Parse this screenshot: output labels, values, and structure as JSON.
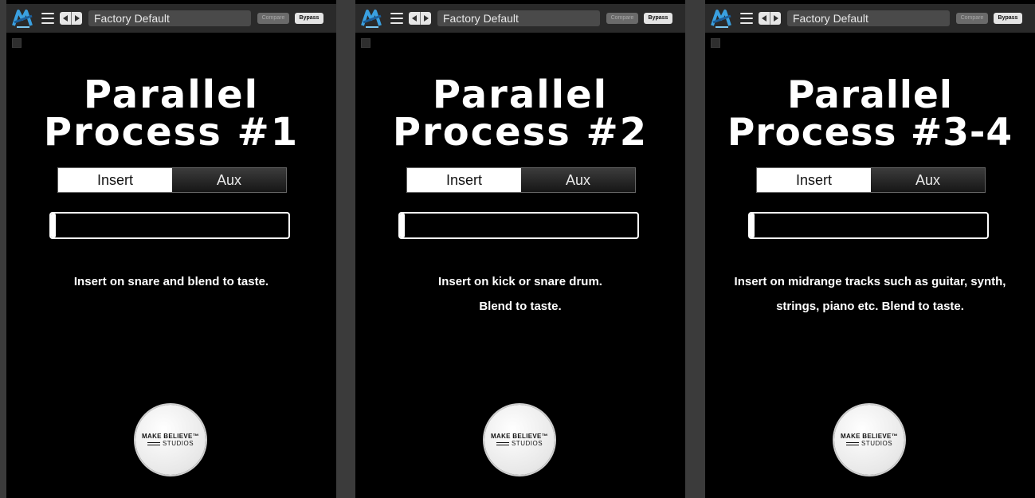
{
  "toolbar": {
    "preset_name": "Factory Default",
    "compare_label": "Compare",
    "bypass_label": "Bypass"
  },
  "panels": [
    {
      "title_line1": "Parallel",
      "title_line2": "Process #1",
      "toggle_insert": "Insert",
      "toggle_aux": "Aux",
      "selected": "Insert",
      "blend_level": 0.02,
      "description_line1": "Insert on snare and blend to taste.",
      "description_line2": ""
    },
    {
      "title_line1": "Parallel",
      "title_line2": "Process #2",
      "toggle_insert": "Insert",
      "toggle_aux": "Aux",
      "selected": "Insert",
      "blend_level": 0.02,
      "description_line1": "Insert on kick or snare drum.",
      "description_line2": "Blend to taste."
    },
    {
      "title_line1": "Parallel",
      "title_line2": "Process #3-4",
      "toggle_insert": "Insert",
      "toggle_aux": "Aux",
      "selected": "Insert",
      "blend_level": 0.02,
      "description_line1": "Insert on midrange tracks such as guitar, synth,",
      "description_line2": "strings, piano etc. Blend to taste."
    }
  ],
  "badge": {
    "line1": "MAKE BELIEVE™",
    "line2": "STUDIOS"
  },
  "colors": {
    "panel_bg": "#000000",
    "toolbar_bg": "#2a2a2a",
    "logo_blue": "#3aa0e0"
  },
  "icons": {
    "logo": "plugin-logo-icon",
    "menu": "hamburger-menu-icon",
    "prev": "triangle-left-icon",
    "next": "triangle-right-icon"
  }
}
